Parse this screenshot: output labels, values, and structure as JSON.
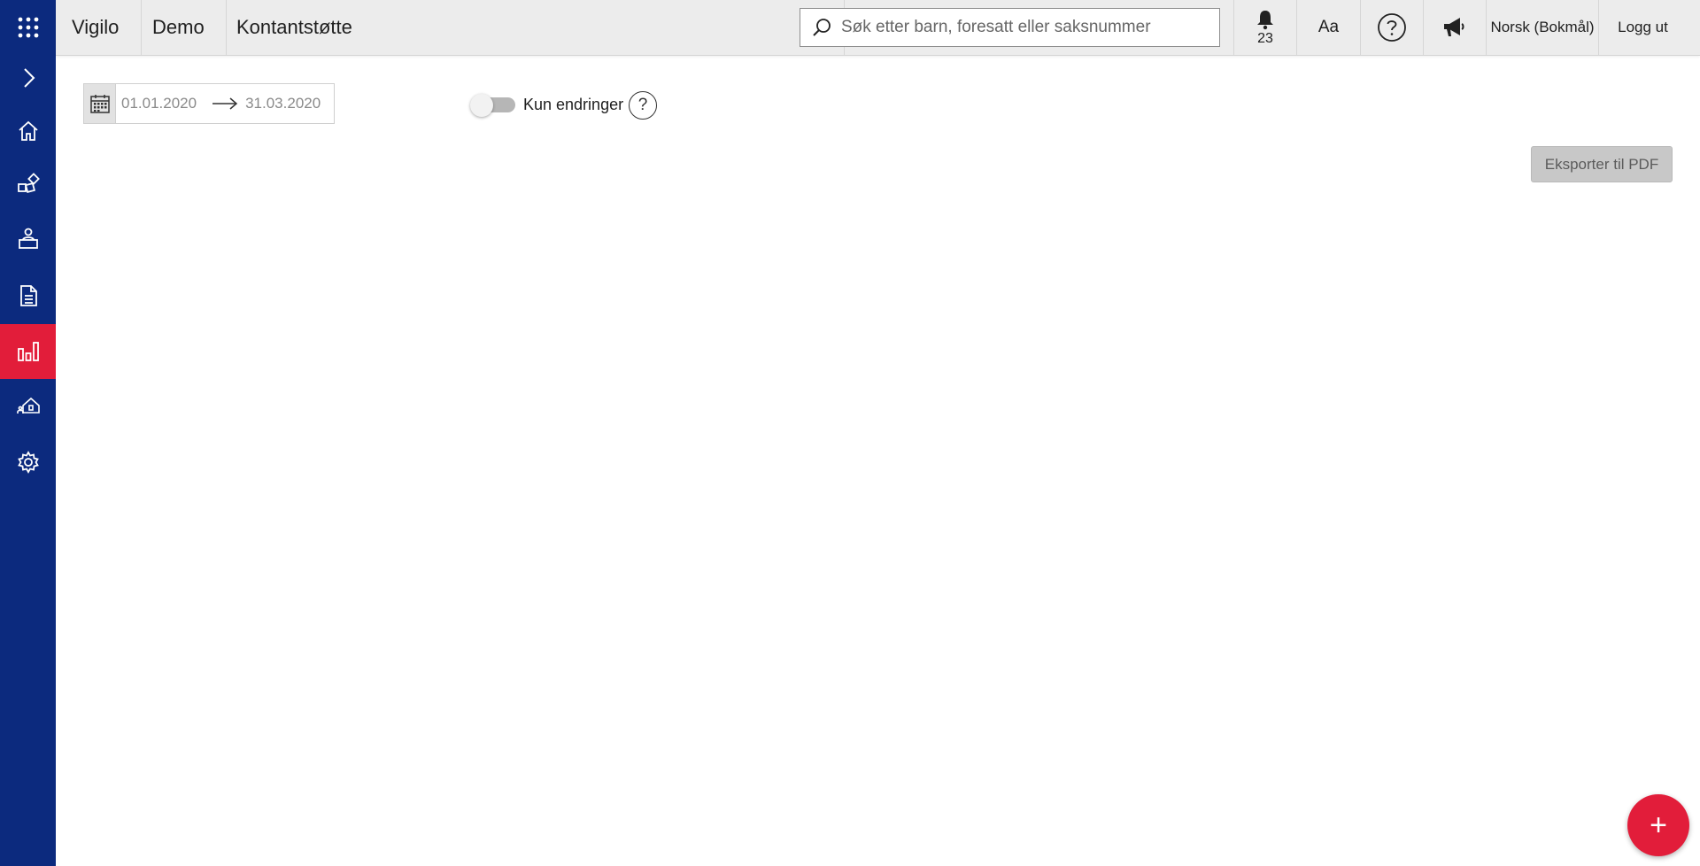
{
  "header": {
    "app_name": "Vigilo",
    "org": "Demo",
    "section": "Kontantstøtte",
    "search": {
      "placeholder": "Søk etter barn, foresatt eller saksnummer",
      "value": ""
    },
    "notifications_count": "23",
    "font_size_label": "Aa",
    "language": "Norsk (Bokmål)",
    "logout_label": "Logg ut"
  },
  "sidebar": {
    "items": [
      {
        "icon": "apps-grid-icon",
        "active": false
      },
      {
        "icon": "chevron-right-icon",
        "active": false
      },
      {
        "icon": "home-icon",
        "active": false
      },
      {
        "icon": "toys-blocks-icon",
        "active": false
      },
      {
        "icon": "person-desk-icon",
        "active": false
      },
      {
        "icon": "document-icon",
        "active": false
      },
      {
        "icon": "bar-chart-icon",
        "active": true
      },
      {
        "icon": "house-family-icon",
        "active": false
      },
      {
        "icon": "gear-icon",
        "active": false
      }
    ]
  },
  "filters": {
    "date_from": "01.01.2020",
    "date_to": "31.03.2020",
    "changes_only_label": "Kun endringer",
    "changes_only_on": false,
    "help_symbol": "?"
  },
  "actions": {
    "export_label": "Eksporter til PDF",
    "add_symbol": "+"
  },
  "colors": {
    "sidebar_bg": "#0c2a7e",
    "accent_red": "#e21d3a",
    "topbar_bg": "#ececec"
  }
}
